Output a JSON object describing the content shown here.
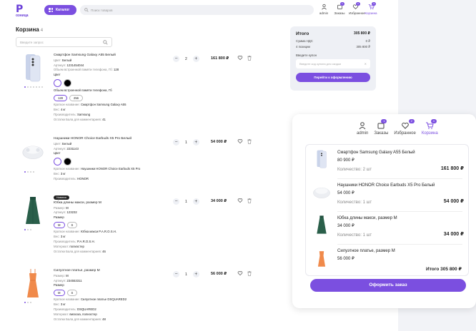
{
  "header": {
    "logo_text": "Р",
    "logo_sub": "озница",
    "catalog_label": "Каталог",
    "search_placeholder": "Поиск товаров",
    "icons": [
      {
        "label": "admin",
        "icon": "user-icon"
      },
      {
        "label": "Заказы",
        "icon": "orders-icon",
        "count": "1"
      },
      {
        "label": "Избранное",
        "icon": "heart-icon",
        "count": "2"
      },
      {
        "label": "Корзина",
        "icon": "cart-icon",
        "count": "4"
      }
    ]
  },
  "cart": {
    "title": "Корзина",
    "count": "4",
    "search_placeholder": "Введите запрос",
    "items": [
      {
        "name": "Смартфон Samsung Galaxy A55 Белый",
        "color_label": "Цвет:",
        "color_value": "Белый",
        "article_label": "Артикул:",
        "article_value": "1231454044",
        "memory_label": "Объем встроенной памяти телефона, Гб:",
        "memory_value": "128",
        "color_select_label": "Цвет",
        "memory_select_label": "Объем встроенной памяти телефона, Гб",
        "memory_options": [
          "128",
          "256"
        ],
        "short_name_label": "Краткое название:",
        "short_name_value": "Смартфон Samsung Galaxy A55",
        "weight_label": "Вес:",
        "weight_value": "4 кг",
        "maker_label": "Производитель:",
        "maker_value": "Samsung",
        "points_label": "Остатки Бала для комментариев:",
        "points_value": "41",
        "qty": "2",
        "price": "161 800 ₽"
      },
      {
        "name": "Наушники HONOR Choice Earbuds X5 Pro Белый",
        "color_label": "Цвет:",
        "color_value": "Белый",
        "article_label": "Артикул:",
        "article_value": "2231143",
        "color_select_label": "Цвет",
        "short_name_label": "Краткое название:",
        "short_name_value": "Наушники HONOR Choice Earbuds X5 Pro",
        "weight_label": "Вес:",
        "weight_value": "3 кг",
        "maker_label": "Производитель:",
        "maker_value": "HONOR",
        "qty": "1",
        "price": "54 000 ₽"
      },
      {
        "badge": "Новинка",
        "name": "Юбка длины макси, размер M",
        "size_label": "Размер:",
        "size_value": "M",
        "article_label": "Артикул:",
        "article_value": "123232",
        "size_select_label": "Размер",
        "size_options": [
          "M",
          "S"
        ],
        "short_name_label": "Краткое название:",
        "short_name_value": "Юбка макси P.A.R.O.S.H.",
        "weight_label": "Вес:",
        "weight_value": "3 кг",
        "maker_label": "Производитель:",
        "maker_value": "P.A.R.O.S.H.",
        "material_label": "Материал:",
        "material_value": "полиэстер",
        "points_label": "Остатки Бала для комментариев:",
        "points_value": "46",
        "qty": "1",
        "price": "34 000 ₽"
      },
      {
        "name": "Силуэтное платье, размер M",
        "size_label": "Размер:",
        "size_value": "M",
        "article_label": "Артикул:",
        "article_value": "234553311",
        "size_select_label": "Размер",
        "size_options": [
          "M",
          "S"
        ],
        "short_name_label": "Краткое название:",
        "short_name_value": "Силуэтное платье DSQUARED2",
        "weight_label": "Вес:",
        "weight_value": "3 кг",
        "maker_label": "Производитель:",
        "maker_value": "DSQUARED2",
        "material_label": "Материал:",
        "material_value": "вискоза, полиэстер",
        "points_label": "Остатки Бала для комментариев:",
        "points_value": "48",
        "qty": "1",
        "price": "56 000 ₽"
      }
    ]
  },
  "summary": {
    "title": "Итого",
    "total": "305 800 ₽",
    "vat_label": "Сумма НДС",
    "vat_value": "0 ₽",
    "positions_label": "4 позиции",
    "positions_value": "305 800 ₽",
    "coupon_label": "Введите купон",
    "coupon_placeholder": "Введите код купона для скидки",
    "checkout_label": "Перейти к оформлению"
  },
  "popup": {
    "icons": [
      {
        "label": "admin"
      },
      {
        "label": "Заказы",
        "count": "1"
      },
      {
        "label": "Избранное",
        "count": "2"
      },
      {
        "label": "Корзина",
        "count": "4"
      }
    ],
    "items": [
      {
        "name": "Смартфон Samsung Galaxy A55 Белый",
        "price": "80 900 ₽",
        "qty_label": "Количество:",
        "qty": "2 шт",
        "sum": "161 800 ₽"
      },
      {
        "name": "Наушники HONOR Choice Earbuds X5 Pro Белый",
        "price": "54 000 ₽",
        "qty_label": "Количество:",
        "qty": "1 шт",
        "sum": "54 000 ₽"
      },
      {
        "name": "Юбка длины макси, размер M",
        "price": "34 000 ₽",
        "qty_label": "Количество:",
        "qty": "1 шт",
        "sum": "34 000 ₽"
      },
      {
        "name": "Силуэтное платье, размер M",
        "price": "56 000 ₽"
      }
    ],
    "total": "Итого 305 800 ₽",
    "checkout_label": "Оформить заказ"
  },
  "colors": {
    "accent": "#7b4fe0",
    "text": "#222222",
    "muted": "#888888",
    "bg": "#f2f3f7"
  }
}
